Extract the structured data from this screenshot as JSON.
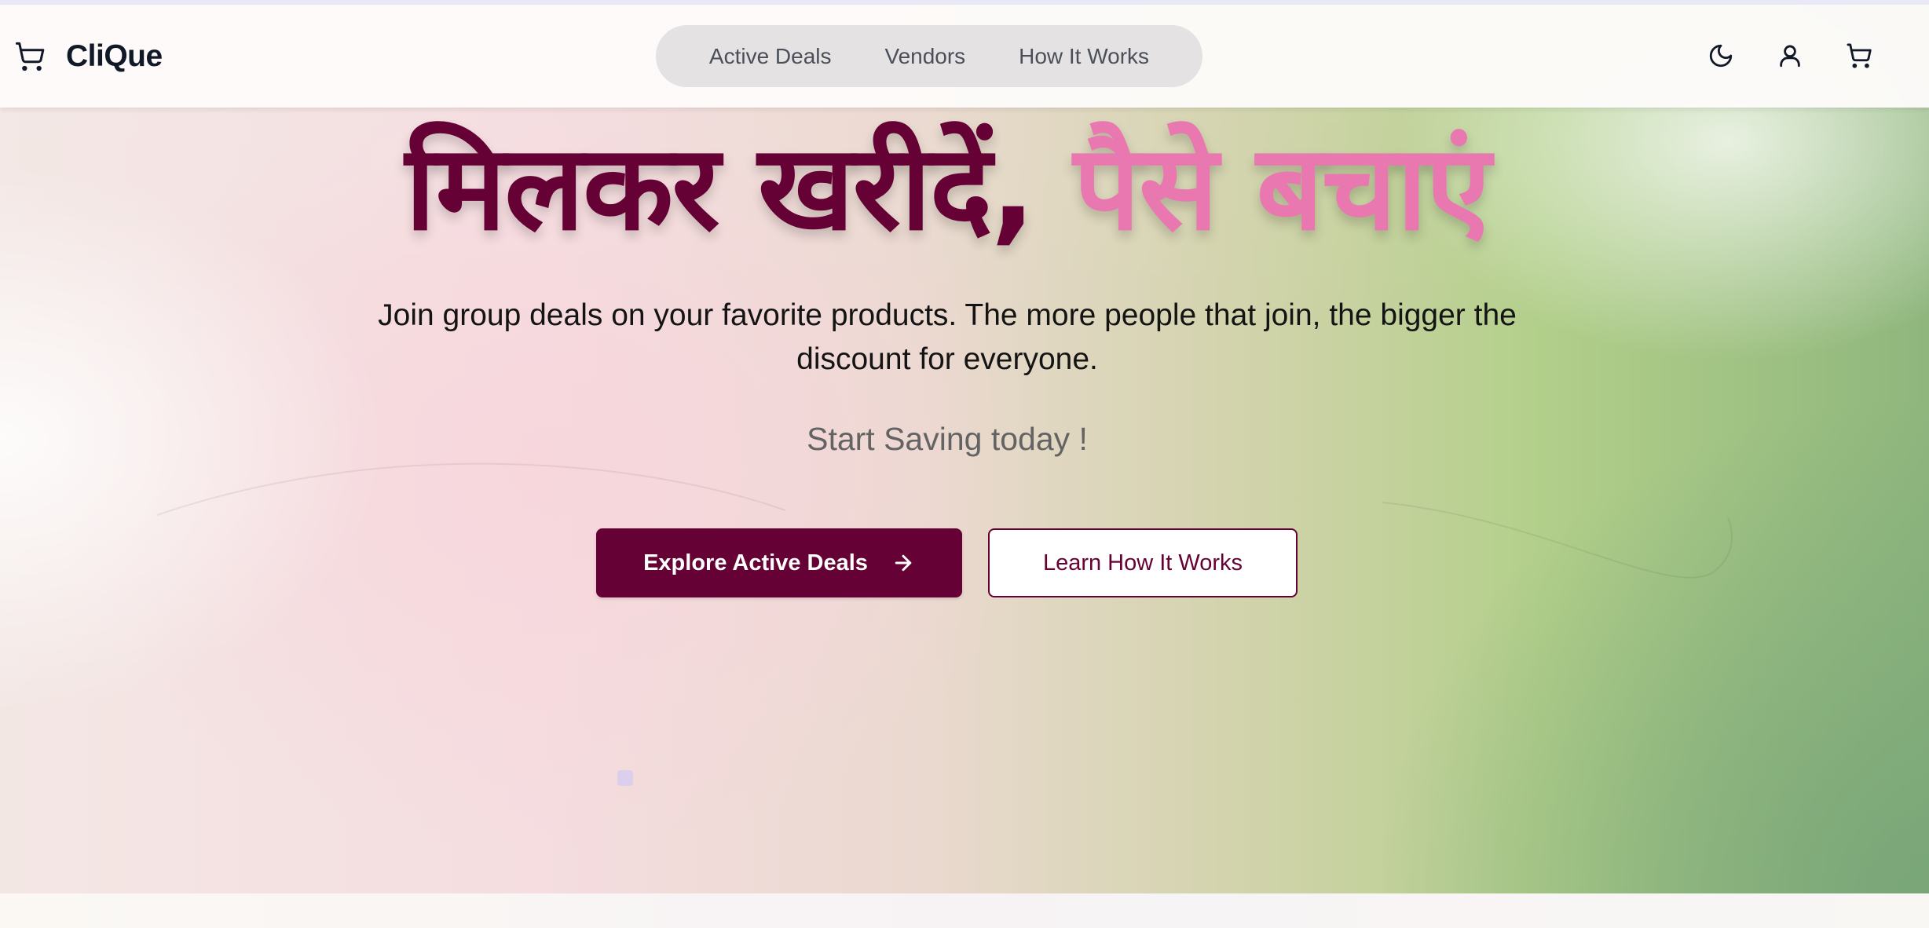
{
  "brand": {
    "name": "CliQue",
    "icon": "shopping-cart-icon"
  },
  "nav": {
    "links": [
      {
        "label": "Active Deals"
      },
      {
        "label": "Vendors"
      },
      {
        "label": "How It Works"
      }
    ],
    "icons": [
      "moon-icon",
      "user-icon",
      "cart-icon"
    ]
  },
  "hero": {
    "title_part1": "मिलकर खरीदें,",
    "title_part2": "पैसे बचाएं",
    "subtitle": "Join group deals on your favorite products. The more people that join, the bigger the discount for everyone.",
    "tagline": "Start Saving today !",
    "primary_button": "Explore Active Deals",
    "primary_button_icon": "arrow-right-icon",
    "secondary_button": "Learn How It Works"
  },
  "colors": {
    "brand_maroon": "#650134",
    "accent_pink": "#e978b0",
    "text_dark": "#111827"
  }
}
